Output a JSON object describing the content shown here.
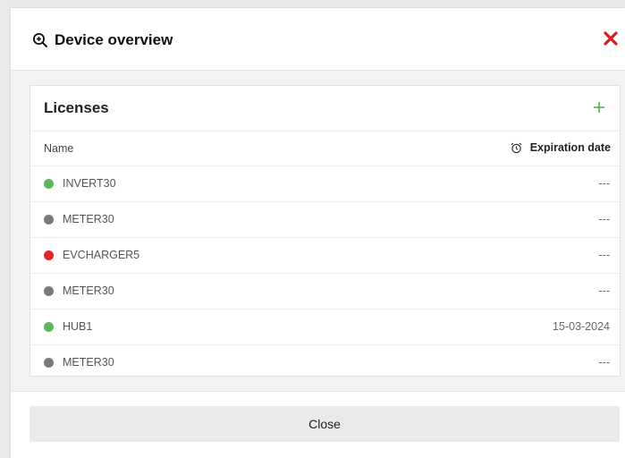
{
  "modal": {
    "title": "Device overview",
    "title_icon": "zoom-in-icon",
    "close_icon": "close-icon",
    "close_icon_color": "#e01b1b"
  },
  "licenses": {
    "title": "Licenses",
    "add_icon": "plus-icon",
    "add_icon_color": "#4caf50",
    "columns": {
      "name": "Name",
      "expiration": "Expiration date",
      "expiration_icon": "alarm-clock-icon"
    },
    "rows": [
      {
        "name": "INVERT30",
        "expiration": "---",
        "status_color": "#5cb85c"
      },
      {
        "name": "METER30",
        "expiration": "---",
        "status_color": "#7a7a7a"
      },
      {
        "name": "EVCHARGER5",
        "expiration": "---",
        "status_color": "#e62424"
      },
      {
        "name": "METER30",
        "expiration": "---",
        "status_color": "#7a7a7a"
      },
      {
        "name": "HUB1",
        "expiration": "15-03-2024",
        "status_color": "#5cb85c"
      },
      {
        "name": "METER30",
        "expiration": "---",
        "status_color": "#7a7a7a"
      }
    ]
  },
  "footer": {
    "close_label": "Close"
  }
}
